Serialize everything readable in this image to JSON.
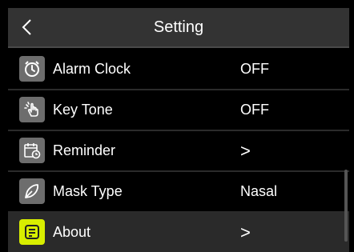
{
  "header": {
    "back_icon": "chevron-left-icon",
    "title": "Setting"
  },
  "settings": {
    "items": [
      {
        "label": "Alarm Clock",
        "value": "OFF",
        "icon": "alarm-clock-icon"
      },
      {
        "label": "Key Tone",
        "value": "OFF",
        "icon": "hand-tap-icon"
      },
      {
        "label": "Reminder",
        "value": ">",
        "icon": "calendar-clock-icon"
      },
      {
        "label": "Mask Type",
        "value": "Nasal",
        "icon": "mask-icon"
      },
      {
        "label": "About",
        "value": ">",
        "icon": "document-icon"
      }
    ]
  },
  "colors": {
    "background": "#000000",
    "header_bg": "#333333",
    "icon_bg": "#6d6d6d",
    "accent": "#d8ee00"
  }
}
